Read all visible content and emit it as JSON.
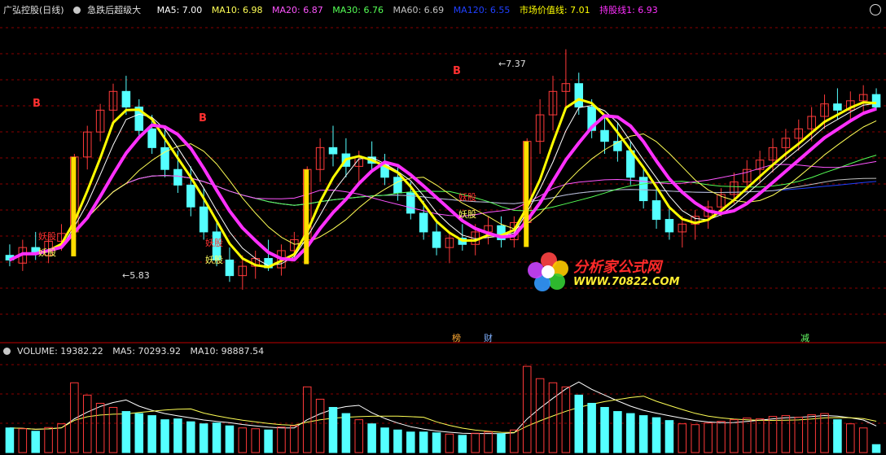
{
  "header": {
    "stock": "广弘控股(日线)",
    "indicator": "急跌后超级大",
    "ma5": "MA5: 7.00",
    "ma10": "MA10: 6.98",
    "ma20": "MA20: 6.87",
    "ma30": "MA30: 6.76",
    "ma60": "MA60: 6.69",
    "ma120": "MA120: 6.55",
    "market_line": "市场价值线: 7.01",
    "hold_line": "持股线1: 6.93"
  },
  "volume_header": {
    "label": "VOLUME: 19382.22",
    "ma5": "MA5: 70293.92",
    "ma10": "MA10: 98887.54"
  },
  "annotations": {
    "high": "7.37",
    "low": "5.83",
    "buy": "B",
    "signal": "妖股",
    "marker_1": "榜",
    "marker_2": "财",
    "marker_3": "减"
  },
  "watermark": {
    "title": "分析家公式网",
    "url": "WWW.70822.COM"
  },
  "colors": {
    "background": "#000000",
    "up": "#ff3a3a",
    "down": "#54ffff",
    "ma5": "#ffffff",
    "ma10": "#ffff55",
    "ma20": "#ff55ff",
    "ma30": "#55ff55",
    "ma60": "#c0c0c0",
    "ma120": "#2040ff",
    "market_line": "#ffff00",
    "hold_line": "#ff30ff",
    "grid": "#8a0000"
  },
  "chart_data": {
    "type": "candlestick",
    "price_range": [
      5.6,
      7.55
    ],
    "volume_range": [
      0,
      230000
    ],
    "candles": [
      [
        6.05,
        6.12,
        5.98,
        6.02,
        60000
      ],
      [
        6.0,
        6.15,
        5.95,
        6.1,
        58000
      ],
      [
        6.1,
        6.2,
        6.02,
        6.06,
        52000
      ],
      [
        6.05,
        6.18,
        6.0,
        6.14,
        61000
      ],
      [
        6.14,
        6.25,
        6.08,
        6.19,
        70000
      ],
      [
        6.2,
        6.7,
        6.18,
        6.68,
        170000
      ],
      [
        6.68,
        6.88,
        6.6,
        6.84,
        140000
      ],
      [
        6.84,
        7.02,
        6.78,
        6.98,
        120000
      ],
      [
        6.98,
        7.15,
        6.9,
        7.1,
        110000
      ],
      [
        7.1,
        7.2,
        6.95,
        7.0,
        100000
      ],
      [
        7.0,
        7.05,
        6.8,
        6.85,
        95000
      ],
      [
        6.86,
        6.95,
        6.7,
        6.74,
        90000
      ],
      [
        6.74,
        6.85,
        6.55,
        6.6,
        80000
      ],
      [
        6.6,
        6.72,
        6.45,
        6.5,
        82000
      ],
      [
        6.5,
        6.62,
        6.3,
        6.36,
        75000
      ],
      [
        6.36,
        6.48,
        6.15,
        6.2,
        70000
      ],
      [
        6.2,
        6.28,
        5.98,
        6.02,
        72000
      ],
      [
        6.02,
        6.1,
        5.88,
        5.92,
        65000
      ],
      [
        5.92,
        6.05,
        5.83,
        5.98,
        60000
      ],
      [
        5.98,
        6.08,
        5.9,
        6.03,
        58000
      ],
      [
        6.03,
        6.15,
        5.95,
        5.97,
        55000
      ],
      [
        5.97,
        6.12,
        5.92,
        6.08,
        62000
      ],
      [
        6.08,
        6.2,
        6.02,
        6.15,
        65000
      ],
      [
        6.15,
        6.62,
        6.12,
        6.6,
        160000
      ],
      [
        6.6,
        6.8,
        6.52,
        6.74,
        130000
      ],
      [
        6.74,
        6.88,
        6.62,
        6.7,
        110000
      ],
      [
        6.7,
        6.8,
        6.55,
        6.62,
        95000
      ],
      [
        6.62,
        6.72,
        6.5,
        6.68,
        80000
      ],
      [
        6.68,
        6.78,
        6.58,
        6.64,
        70000
      ],
      [
        6.64,
        6.7,
        6.5,
        6.55,
        60000
      ],
      [
        6.55,
        6.62,
        6.4,
        6.45,
        55000
      ],
      [
        6.45,
        6.52,
        6.28,
        6.32,
        50000
      ],
      [
        6.32,
        6.4,
        6.15,
        6.2,
        50000
      ],
      [
        6.2,
        6.28,
        6.05,
        6.1,
        48000
      ],
      [
        6.1,
        6.2,
        6.0,
        6.16,
        45000
      ],
      [
        6.16,
        6.25,
        6.08,
        6.12,
        42000
      ],
      [
        6.12,
        6.25,
        6.05,
        6.2,
        47000
      ],
      [
        6.2,
        6.3,
        6.12,
        6.24,
        50000
      ],
      [
        6.24,
        6.3,
        6.1,
        6.15,
        46000
      ],
      [
        6.15,
        6.3,
        6.1,
        6.26,
        55000
      ],
      [
        6.26,
        6.8,
        6.22,
        6.78,
        210000
      ],
      [
        6.78,
        7.05,
        6.7,
        6.95,
        180000
      ],
      [
        6.95,
        7.2,
        6.85,
        7.1,
        170000
      ],
      [
        7.1,
        7.37,
        7.0,
        7.15,
        160000
      ],
      [
        7.15,
        7.22,
        6.95,
        7.0,
        140000
      ],
      [
        7.0,
        7.05,
        6.8,
        6.85,
        120000
      ],
      [
        6.85,
        6.95,
        6.7,
        6.78,
        110000
      ],
      [
        6.78,
        6.9,
        6.65,
        6.72,
        100000
      ],
      [
        6.72,
        6.78,
        6.5,
        6.55,
        95000
      ],
      [
        6.55,
        6.62,
        6.35,
        6.4,
        90000
      ],
      [
        6.4,
        6.48,
        6.22,
        6.28,
        85000
      ],
      [
        6.28,
        6.36,
        6.15,
        6.2,
        78000
      ],
      [
        6.2,
        6.3,
        6.1,
        6.25,
        70000
      ],
      [
        6.25,
        6.34,
        6.15,
        6.3,
        68000
      ],
      [
        6.3,
        6.4,
        6.22,
        6.36,
        72000
      ],
      [
        6.36,
        6.48,
        6.3,
        6.44,
        76000
      ],
      [
        6.44,
        6.58,
        6.38,
        6.52,
        80000
      ],
      [
        6.52,
        6.66,
        6.46,
        6.6,
        84000
      ],
      [
        6.6,
        6.72,
        6.52,
        6.66,
        82000
      ],
      [
        6.66,
        6.8,
        6.58,
        6.74,
        88000
      ],
      [
        6.74,
        6.86,
        6.66,
        6.8,
        90000
      ],
      [
        6.8,
        6.92,
        6.72,
        6.86,
        86000
      ],
      [
        6.86,
        7.0,
        6.78,
        6.94,
        92000
      ],
      [
        6.94,
        7.08,
        6.86,
        7.02,
        95000
      ],
      [
        7.02,
        7.12,
        6.92,
        6.98,
        80000
      ],
      [
        6.98,
        7.1,
        6.9,
        7.04,
        70000
      ],
      [
        7.04,
        7.14,
        6.96,
        7.08,
        60000
      ],
      [
        7.08,
        7.12,
        6.98,
        7.0,
        19382
      ]
    ]
  }
}
